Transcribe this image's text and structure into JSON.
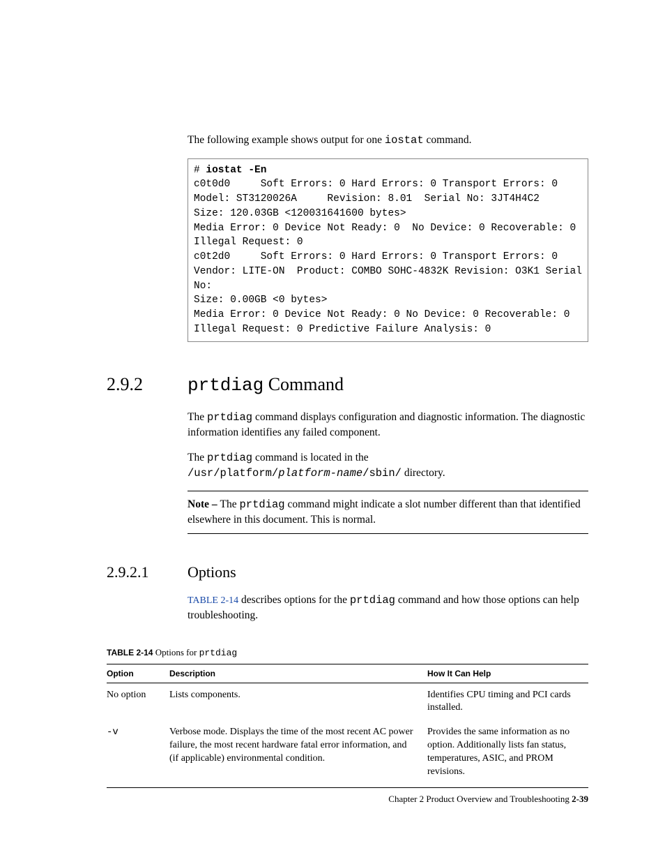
{
  "intro": {
    "pre": "The following example shows output for one ",
    "cmd": "iostat",
    "post": " command."
  },
  "code": {
    "prompt": "# ",
    "command": "iostat -En",
    "lines": [
      "c0t0d0     Soft Errors: 0 Hard Errors: 0 Transport Errors: 0",
      "Model: ST3120026A     Revision: 8.01  Serial No: 3JT4H4C2",
      "Size: 120.03GB <120031641600 bytes>",
      "Media Error: 0 Device Not Ready: 0  No Device: 0 Recoverable: 0",
      "Illegal Request: 0",
      "c0t2d0     Soft Errors: 0 Hard Errors: 0 Transport Errors: 0",
      "Vendor: LITE-ON  Product: COMBO SOHC-4832K Revision: O3K1 Serial",
      "No:",
      "Size: 0.00GB <0 bytes>",
      "Media Error: 0 Device Not Ready: 0 No Device: 0 Recoverable: 0",
      "Illegal Request: 0 Predictive Failure Analysis: 0"
    ]
  },
  "section": {
    "number": "2.9.2",
    "title_cmd": "prtdiag",
    "title_rest": " Command"
  },
  "sec_paras": {
    "p1_a": "The ",
    "p1_cmd": "prtdiag",
    "p1_b": " command displays configuration and diagnostic information. The diagnostic information identifies any failed component.",
    "p2_a": "The ",
    "p2_cmd": "prtdiag",
    "p2_b": " command is located in the",
    "p2_path": "/usr/platform/",
    "p2_var": "platform-name",
    "p2_path2": "/sbin/",
    "p2_c": " directory."
  },
  "note": {
    "label": "Note – ",
    "a": "The ",
    "cmd": "prtdiag",
    "b": " command might indicate a slot number different than that identified elsewhere in this document. This is normal."
  },
  "subsection": {
    "number": "2.9.2.1",
    "title": "Options"
  },
  "sub_para": {
    "xref": "TABLE 2-14",
    "a": " describes options for the ",
    "cmd": "prtdiag",
    "b": " command and how those options can help troubleshooting."
  },
  "table": {
    "label": "TABLE 2-14",
    "caption_a": "   Options for ",
    "caption_cmd": "prtdiag",
    "headers": [
      "Option",
      "Description",
      "How It Can Help"
    ],
    "rows": [
      {
        "option": "No option",
        "description": "Lists components.",
        "help": "Identifies CPU timing and PCI cards installed."
      },
      {
        "option": "-v",
        "description": "Verbose mode. Displays the time of the most recent AC power failure, the most recent hardware fatal error information, and (if applicable) environmental condition.",
        "help": "Provides the same information as no option. Additionally lists fan status, temperatures, ASIC, and PROM revisions."
      }
    ]
  },
  "footer": {
    "chapter": "Chapter 2    Product Overview and Troubleshooting",
    "spacer": "    ",
    "page": "2-39"
  }
}
